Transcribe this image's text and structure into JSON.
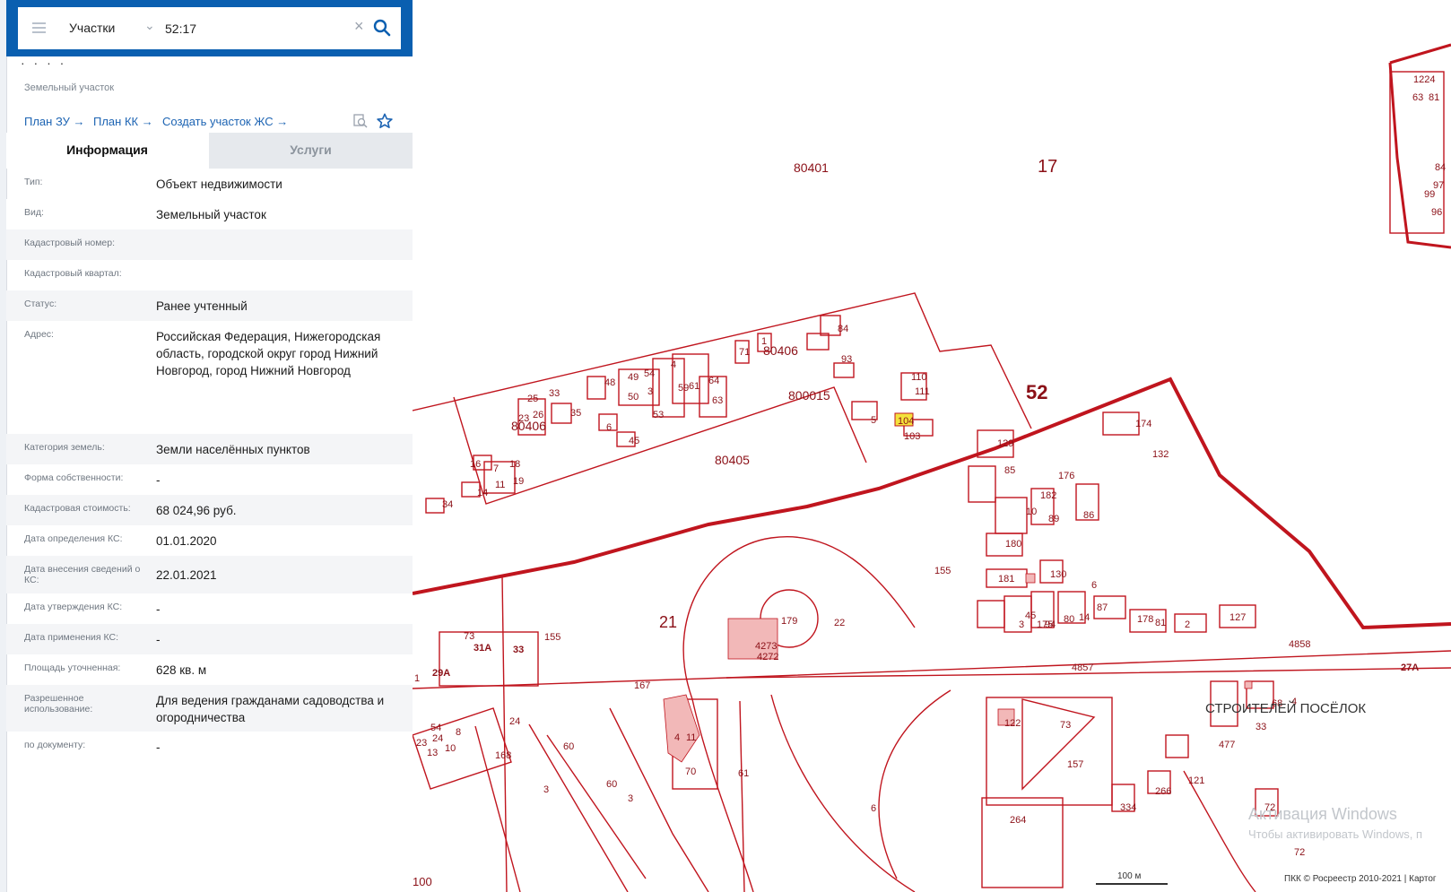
{
  "search": {
    "layer": "Участки",
    "value": "52:17"
  },
  "object": {
    "dots": "· · · ·",
    "type_caption": "Земельный участок",
    "links": [
      "План ЗУ →",
      "План КК →",
      "Создать участок ЖС →"
    ]
  },
  "tabs": {
    "info": "Информация",
    "services": "Услуги"
  },
  "info_rows": [
    {
      "label": "Тип:",
      "value": "Объект недвижимости"
    },
    {
      "label": "Вид:",
      "value": "Земельный участок"
    },
    {
      "label": "Кадастровый номер:",
      "value": ""
    },
    {
      "label": "Кадастровый квартал:",
      "value": ""
    },
    {
      "label": "Статус:",
      "value": "Ранее учтенный"
    },
    {
      "label": "Адрес:",
      "value": "Российская Федерация, Нижегородская область, городской округ город Нижний Новгород, город Нижний Новгород"
    },
    {
      "label": "Категория земель:",
      "value": "Земли населённых пунктов"
    },
    {
      "label": "Форма собственности:",
      "value": "-"
    },
    {
      "label": "Кадастровая стоимость:",
      "value": "68 024,96 руб."
    },
    {
      "label": "Дата определения КС:",
      "value": "01.01.2020"
    },
    {
      "label": "Дата внесения сведений о КС:",
      "value": "22.01.2021"
    },
    {
      "label": "Дата утверждения КС:",
      "value": "-"
    },
    {
      "label": "Дата применения КС:",
      "value": "-"
    },
    {
      "label": "Площадь уточненная:",
      "value": "628 кв. м"
    },
    {
      "label": "Разрешенное использование:",
      "value": "Для ведения гражданами садоводства и огородничества"
    },
    {
      "label": "по документу:",
      "value": "-"
    }
  ],
  "map": {
    "line_color": "#c0151e",
    "fill_color": "#f2b8b8",
    "highlight_color": "#f4e23c",
    "district_labels": [
      "17",
      "52",
      "21"
    ],
    "quarter_labels": [
      "80401",
      "80406",
      "80406",
      "80405",
      "800015"
    ],
    "parcel_labels": [
      "155",
      "155",
      "157",
      "22",
      "167",
      "60",
      "60",
      "3",
      "3",
      "61",
      "6",
      "70",
      "73",
      "264",
      "4857",
      "4858",
      "27A",
      "24",
      "168",
      "179",
      "4273",
      "4272",
      "31A",
      "33",
      "29A",
      "73",
      "16",
      "14",
      "34",
      "7",
      "18",
      "11",
      "19",
      "23",
      "26",
      "25",
      "33",
      "35",
      "6",
      "45",
      "48",
      "49",
      "50",
      "54",
      "3",
      "53",
      "4",
      "59",
      "61",
      "64",
      "63",
      "71",
      "1",
      "84",
      "93",
      "110",
      "111",
      "5",
      "104",
      "103",
      "129",
      "174",
      "132",
      "85",
      "176",
      "182",
      "10",
      "89",
      "86",
      "180",
      "181",
      "130",
      "6",
      "45",
      "3",
      "175",
      "94",
      "80",
      "14",
      "87",
      "178",
      "81",
      "2",
      "127",
      "122",
      "477",
      "33",
      "68",
      "4",
      "266",
      "121",
      "334",
      "72",
      "72",
      "1224",
      "63",
      "81",
      "84",
      "99",
      "96",
      "97",
      "100",
      "54",
      "24",
      "13",
      "10",
      "23",
      "8",
      "4",
      "11",
      "1",
      "7"
    ],
    "place_name": "СТРОИТЕЛЕЙ ПОСЁЛОК",
    "scale": "100 м",
    "copyright": "ПКК © Росреестр 2010-2021 | Картог",
    "watermark_title": "Активация Windows",
    "watermark_sub": "Чтобы активировать Windows, п"
  }
}
